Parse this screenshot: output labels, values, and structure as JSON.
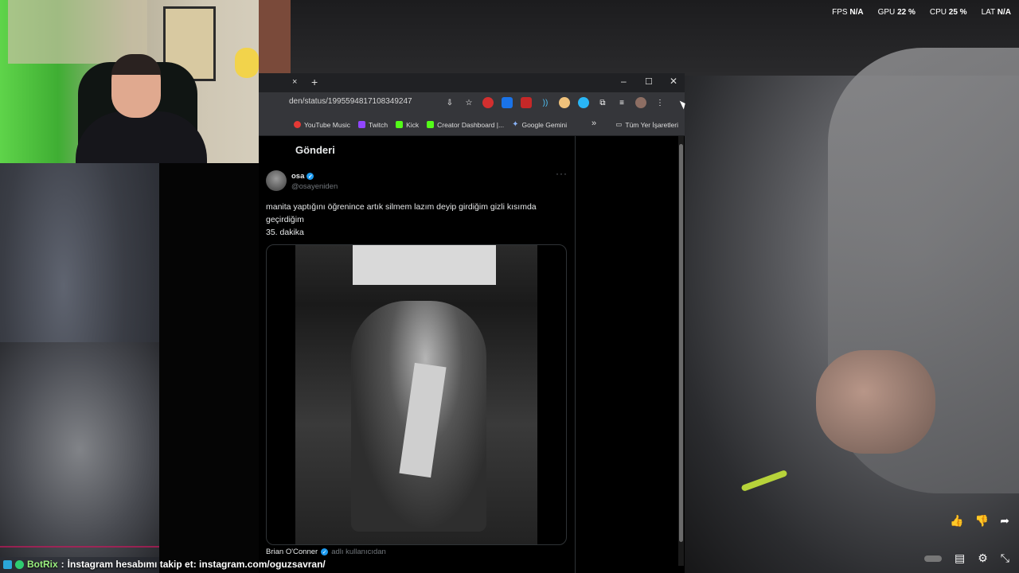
{
  "overlay": {
    "fps_label": "FPS",
    "fps_value": "N/A",
    "gpu_label": "GPU",
    "gpu_value": "22 %",
    "cpu_label": "CPU",
    "cpu_value": "25 %",
    "lat_label": "LAT",
    "lat_value": "N/A"
  },
  "browser": {
    "url": "den/status/1995594817108349247",
    "new_tab": "+",
    "close_tab": "×",
    "bookmarks": [
      {
        "label": "YouTube Music",
        "color": "#e53935"
      },
      {
        "label": "Twitch",
        "color": "#9146ff"
      },
      {
        "label": "Kick",
        "color": "#53fc18"
      },
      {
        "label": "Creator Dashboard |...",
        "color": "#53fc18"
      },
      {
        "label": "Google Gemini",
        "color": "#8ab4f8"
      }
    ],
    "bookmarks_more": "»",
    "all_bookmarks": "Tüm Yer İşaretleri"
  },
  "page": {
    "title": "Gönderi",
    "tweet": {
      "name": "osa",
      "handle": "@osayeniden",
      "text_line1": "manita yaptığını öğrenince artık silmem lazım deyip girdiğim gizli kısımda",
      "text_line2": "geçirdiğim",
      "text_line3": "35. dakika",
      "more": "···"
    },
    "author_line": {
      "name": "Brian O'Conner",
      "suffix": "adlı kullanıcıdan"
    }
  },
  "chat": {
    "user": "BotRix",
    "separator": ":",
    "message": "İnstagram hesabımı takip et: instagram.com/oguzsavran/"
  },
  "player": {
    "like": "👍",
    "dislike": "👎",
    "share": "➦"
  }
}
